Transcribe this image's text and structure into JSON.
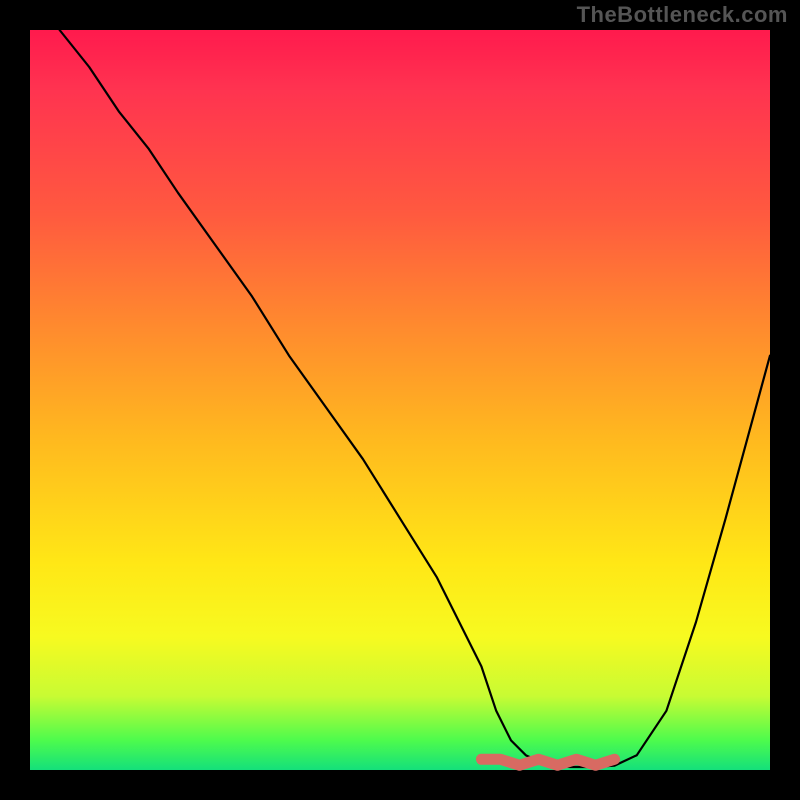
{
  "watermark": "TheBottleneck.com",
  "colors": {
    "frame": "#000000",
    "watermark": "#555555",
    "curve": "#000000",
    "trough_highlight": "#d86a62",
    "gradient_top": "#ff1a4d",
    "gradient_bottom": "#14e07b"
  },
  "chart_data": {
    "type": "line",
    "title": "",
    "xlabel": "",
    "ylabel": "",
    "xlim": [
      0,
      100
    ],
    "ylim": [
      0,
      100
    ],
    "grid": false,
    "legend": false,
    "note": "Values read off the plot by position; y large = near top (red), y small = near bottom (green).",
    "x": [
      4,
      8,
      12,
      16,
      20,
      25,
      30,
      35,
      40,
      45,
      50,
      55,
      58,
      61,
      63,
      65,
      67,
      70,
      73,
      76,
      79,
      82,
      86,
      90,
      94,
      100
    ],
    "y": [
      100,
      95,
      89,
      84,
      78,
      71,
      64,
      56,
      49,
      42,
      34,
      26,
      20,
      14,
      8,
      4,
      2,
      0.6,
      0.4,
      0.4,
      0.6,
      2,
      8,
      20,
      34,
      56
    ],
    "trough_highlight": {
      "x_range": [
        61,
        79
      ],
      "y_approx": 0.5
    }
  }
}
